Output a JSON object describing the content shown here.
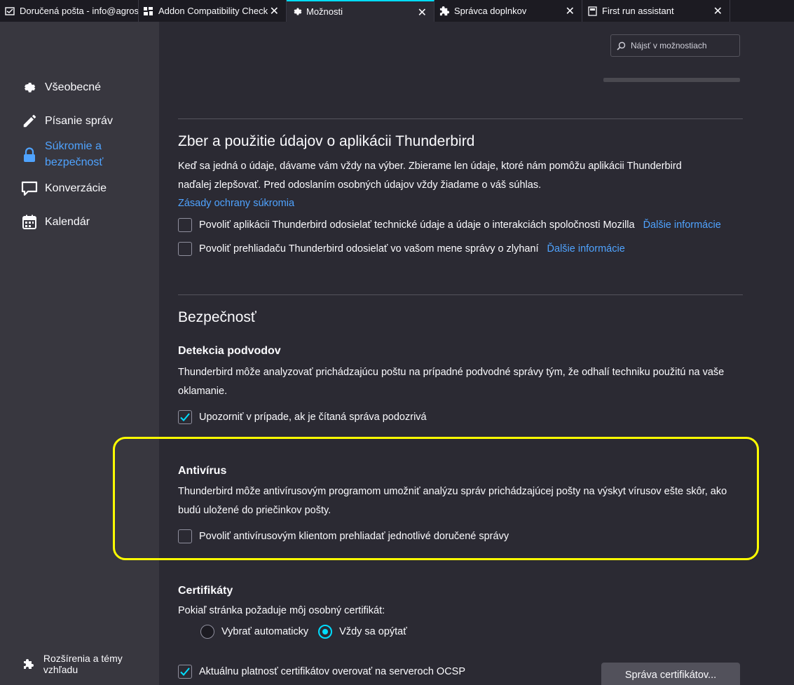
{
  "tabs": [
    {
      "label": "Doručená pošta - info@agrosho",
      "icon": "inbox-icon",
      "active": false
    },
    {
      "label": "Addon Compatibility Check",
      "icon": "addon-check-icon",
      "active": false
    },
    {
      "label": "Možnosti",
      "icon": "gear-icon",
      "active": true
    },
    {
      "label": "Správca doplnkov",
      "icon": "puzzle-icon",
      "active": false
    },
    {
      "label": "First run assistant",
      "icon": "page-icon",
      "active": false
    }
  ],
  "sidebar": {
    "items": [
      {
        "label": "Všeobecné",
        "icon": "gear-icon"
      },
      {
        "label": "Písanie správ",
        "icon": "pencil-icon"
      },
      {
        "label": "Súkromie a bezpečnosť",
        "label_line1": "Súkromie a",
        "label_line2": "bezpečnosť",
        "icon": "lock-icon",
        "selected": true
      },
      {
        "label": "Konverzácie",
        "icon": "chat-icon"
      },
      {
        "label": "Kalendár",
        "icon": "calendar-icon"
      }
    ],
    "bottom_link": "Rozšírenia a témy vzhľadu"
  },
  "search": {
    "placeholder": "Nájsť v možnostiach"
  },
  "data_collection": {
    "title": "Zber a použitie údajov o aplikácii Thunderbird",
    "description_line1": "Keď sa jedná o údaje, dávame vám vždy na výber. Zbierame len údaje, ktoré nám pomôžu aplikácii Thunderbird",
    "description_line2": "naďalej zlepšovať. Pred odoslaním osobných údajov vždy žiadame o váš súhlas.",
    "privacy_link": "Zásady ochrany súkromia",
    "option1": {
      "label": "Povoliť aplikácii Thunderbird odosielať technické údaje a údaje o interakciách spoločnosti Mozilla",
      "link": "Ďalšie informácie",
      "checked": false
    },
    "option2": {
      "label": "Povoliť prehliadaču Thunderbird odosielať vo vašom mene správy o zlyhaní",
      "link": "Ďalšie informácie",
      "checked": false
    }
  },
  "security": {
    "title": "Bezpečnosť",
    "phishing": {
      "title": "Detekcia podvodov",
      "description_line1": "Thunderbird môže analyzovať prichádzajúcu poštu na prípadné podvodné správy tým, že odhalí techniku použitú na vaše",
      "description_line2": "oklamanie.",
      "option": {
        "label": "Upozorniť v prípade, ak je čítaná správa podozrivá",
        "checked": true
      }
    },
    "antivirus": {
      "title": "Antivírus",
      "description_line1": "Thunderbird môže antivírusovým programom umožniť analýzu správ prichádzajúcej pošty na výskyt vírusov ešte skôr, ako",
      "description_line2": "budú uložené do priečinkov pošty.",
      "option": {
        "label": "Povoliť antivírusovým klientom prehliadať jednotlivé doručené správy",
        "checked": false
      }
    },
    "certificates": {
      "title": "Certifikáty",
      "description": "Pokiaľ stránka požaduje môj osobný certifikát:",
      "radio_auto": "Vybrať automaticky",
      "radio_ask": "Vždy sa opýtať",
      "selected": "Vždy sa opýtať",
      "ocsp": {
        "label": "Aktuálnu platnosť certifikátov overovať na serveroch OCSP",
        "checked": true
      },
      "manage_button": "Správa certifikátov..."
    }
  },
  "colors": {
    "accent": "#00ddff",
    "link": "#4fa3ff",
    "highlight": "#ffff00",
    "background": "#2b2a33",
    "sidebar": "#38373f"
  }
}
